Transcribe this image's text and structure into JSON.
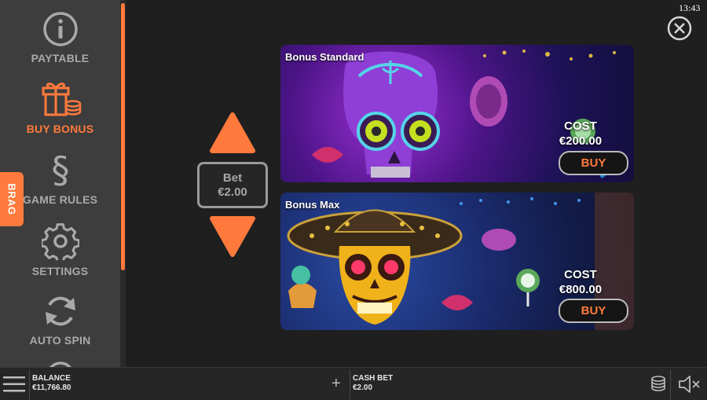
{
  "sidebar": {
    "items": [
      {
        "label": "PAYTABLE",
        "icon": "info-icon"
      },
      {
        "label": "BUY BONUS",
        "icon": "gift-icon",
        "active": true
      },
      {
        "label": "GAME RULES",
        "icon": "section-icon"
      },
      {
        "label": "SETTINGS",
        "icon": "gear-icon"
      },
      {
        "label": "AUTO SPIN",
        "icon": "refresh-icon"
      }
    ],
    "brag_label": "BRAG"
  },
  "bet": {
    "label": "Bet",
    "value": "€2.00"
  },
  "bonuses": [
    {
      "title": "Bonus Standard",
      "cost_label": "COST",
      "cost_value": "€200.00",
      "buy_label": "BUY"
    },
    {
      "title": "Bonus Max",
      "cost_label": "COST",
      "cost_value": "€800.00",
      "buy_label": "BUY"
    }
  ],
  "clock": "13:43",
  "bottom": {
    "balance_label": "BALANCE",
    "balance_value": "€11,766.80",
    "cashbet_label": "CASH BET",
    "cashbet_value": "€2.00",
    "plus": "+"
  },
  "colors": {
    "accent": "#ff7a3c",
    "sidebar_bg": "#3d3d3d",
    "text_muted": "#a9a9a9"
  }
}
